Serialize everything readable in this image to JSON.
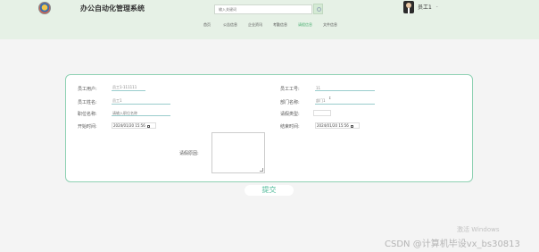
{
  "header": {
    "app_title": "办公自动化管理系统",
    "search_placeholder": "输入关键词",
    "user_name": "员工1",
    "user_caret": "⌄"
  },
  "nav": {
    "items": [
      "首页",
      "公告信息",
      "企业资讯",
      "考勤信息",
      "请假信息",
      "文件信息"
    ],
    "active_index": 4
  },
  "form": {
    "employee_account": {
      "label": "员工用户:",
      "value": "员工1-111111"
    },
    "employee_no": {
      "label": "员工工号:",
      "value": "11"
    },
    "employee_name": {
      "label": "员工姓名:",
      "value": "员工1"
    },
    "department": {
      "label": "部门名称:",
      "value": "部门1"
    },
    "position": {
      "label": "职位名称:",
      "placeholder": "请输入职位名称"
    },
    "leave_type": {
      "label": "请假类型:",
      "value": ""
    },
    "start_time": {
      "label": "开始时间:",
      "value": "2024/01/20 15:56"
    },
    "end_time": {
      "label": "结束时间:",
      "value": "2024/01/20 15:56"
    },
    "leave_reason": {
      "label": "请假原因:",
      "value": ""
    }
  },
  "submit_label": "提交",
  "watermarks": {
    "activate": "激活 Windows",
    "csdn": "CSDN @计算机毕设vx_bs30813"
  },
  "colors": {
    "header_bg": "#e6f1e6",
    "accent": "#4db897",
    "card_border": "#8fd1b3",
    "page_bg": "#f4f4f4"
  }
}
